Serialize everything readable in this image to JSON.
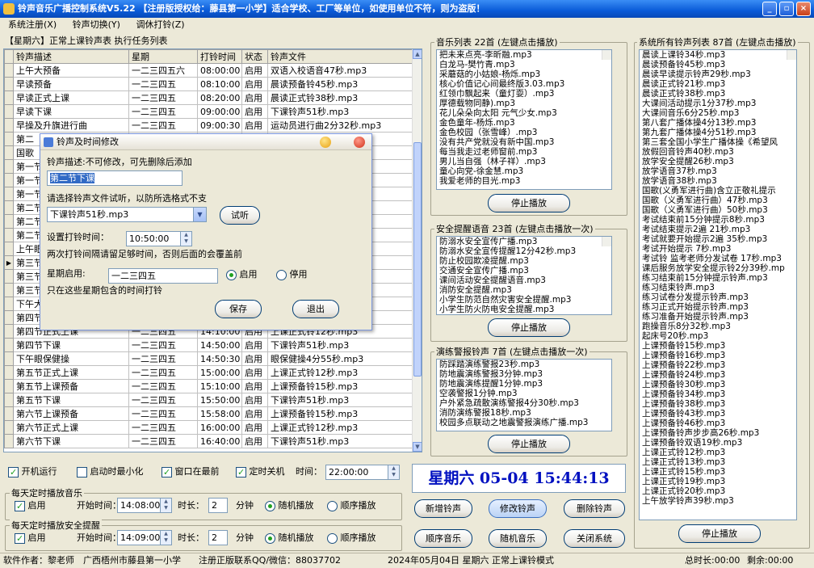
{
  "window": {
    "title": "铃声音乐广播控制系统V5.22 【注册版授权给：藤县第一小学】适合学校、工厂等单位，如使用单位不符，则为盗版！",
    "min_glyph": "_",
    "restore_glyph": "▫",
    "close_glyph": "×"
  },
  "menu": [
    "系统注册(X)",
    "铃声切换(Y)",
    "调休打铃(Z)"
  ],
  "schedule": {
    "title": "【星期六】正常上课铃声表 执行任务列表",
    "columns": [
      "铃声描述",
      "星期",
      "打铃时间",
      "状态",
      "铃声文件"
    ],
    "current_row_marker": "▶",
    "rows": [
      [
        "上午大预备",
        "一二三四五六",
        "08:00:00",
        "启用",
        "双语入校语音47秒.mp3"
      ],
      [
        "早读预备",
        "一二三四五",
        "08:10:00",
        "启用",
        "晨读预备铃45秒.mp3"
      ],
      [
        "早读正式上课",
        "一二三四五",
        "08:20:00",
        "启用",
        "晨读正式铃38秒.mp3"
      ],
      [
        "早读下课",
        "一二三四五",
        "09:00:00",
        "启用",
        "下课铃声51秒.mp3"
      ],
      [
        "早操及升旗进行曲",
        "一二三四五",
        "09:00:30",
        "启用",
        "运动员进行曲2分32秒.mp3"
      ],
      [
        "第二",
        "",
        "",
        "",
        "操《希望"
      ],
      [
        "国歌",
        "",
        "",
        "",
        ""
      ],
      [
        "第一节",
        "",
        "",
        "",
        ""
      ],
      [
        "第一节",
        "",
        "",
        "",
        ""
      ],
      [
        "第一节",
        "",
        "",
        "",
        ""
      ],
      [
        "第二节",
        "",
        "",
        "",
        ""
      ],
      [
        "第二节",
        "",
        "",
        "",
        ""
      ],
      [
        "第二节",
        "",
        "",
        "",
        ""
      ],
      [
        "上午眼",
        "",
        "",
        "",
        ""
      ],
      [
        "第三节",
        "",
        "",
        "",
        ""
      ],
      [
        "第三节",
        "",
        "",
        "",
        ""
      ],
      [
        "第三节",
        "",
        "",
        "",
        ""
      ],
      [
        "下午大",
        "",
        "",
        "",
        ""
      ],
      [
        "第四节",
        "",
        "",
        "",
        ""
      ],
      [
        "第四节正式上课",
        "一二三四五",
        "14:10:00",
        "启用",
        "上课正式铃12秒.mp3"
      ],
      [
        "第四节下课",
        "一二三四五",
        "14:50:00",
        "启用",
        "下课铃声51秒.mp3"
      ],
      [
        "下午眼保健操",
        "一二三四五",
        "14:50:30",
        "启用",
        "眼保健操4分55秒.mp3"
      ],
      [
        "第五节正式上课",
        "一二三四五",
        "15:00:00",
        "启用",
        "上课正式铃12秒.mp3"
      ],
      [
        "第五节上课预备",
        "一二三四五",
        "15:10:00",
        "启用",
        "上课预备铃15秒.mp3"
      ],
      [
        "第五节下课",
        "一二三四五",
        "15:50:00",
        "启用",
        "下课铃声51秒.mp3"
      ],
      [
        "第六节上课预备",
        "一二三四五",
        "15:58:00",
        "启用",
        "上课预备铃15秒.mp3"
      ],
      [
        "第六节正式上课",
        "一二三四五",
        "16:00:00",
        "启用",
        "上课正式铃12秒.mp3"
      ],
      [
        "第六节下课",
        "一二三四五",
        "16:40:00",
        "启用",
        "下课铃声51秒.mp3"
      ]
    ],
    "scroll_up": "▲",
    "scroll_down": "▼"
  },
  "music": {
    "title": "音乐列表 22首 (左键点击播放)",
    "items": [
      "把未来点亮-李昕融.mp3",
      "白龙马-樊竹青.mp3",
      "采蘑菇的小姑娘-杨烁.mp3",
      "核心价值记心间最终版3.03.mp3",
      "红领巾飘起来（童灯耍）.mp3",
      "厚德载物同静).mp3",
      "花儿朵朵向太阳 元气少女.mp3",
      "金色童年-杨烁.mp3",
      "金色校园（张雪峰）.mp3",
      "没有共产党就没有新中国.mp3",
      "每当我走过老师窗前.mp3",
      "男儿当自强（林子祥）.mp3",
      "童心向党-徐金慧.mp3",
      "我爱老师的目光.mp3"
    ],
    "stop_label": "停止播放"
  },
  "safety": {
    "title": "安全提醒语音 23首 (左键点击播放一次)",
    "items": [
      "防溺水安全宣传广播.mp3",
      "防溺水安全宣传提醒12分42秒.mp3",
      "防止校园欺凌提醒.mp3",
      "交通安全宣传广播.mp3",
      "课间活动安全提醒语音.mp3",
      "消防安全提醒.mp3",
      "小学生防范自然灾害安全提醒.mp3",
      "小学生防火防电安全提醒.mp3"
    ],
    "stop_label": "停止播放"
  },
  "drill": {
    "title": "演练警报铃声 7首 (左键点击播放一次)",
    "items": [
      "防踩踏演练警报23秒.mp3",
      "防地震演练警报3分钟.mp3",
      "防地震演练提醒1分钟.mp3",
      "空袭警报1分钟.mp3",
      "户外紧急疏散演练警报4分30秒.mp3",
      "消防演练警报18秒.mp3",
      "校园多点联动之地震警报演练广播.mp3"
    ],
    "stop_label": "停止播放"
  },
  "allrings": {
    "title": "系统所有铃声列表 87首 (左键点击播放)",
    "items": [
      "晨读上课铃34秒.mp3",
      "晨读预备铃45秒.mp3",
      "晨读早读提示铃声29秒.mp3",
      "晨读正式铃21秒.mp3",
      "晨读正式铃38秒.mp3",
      "大课间活动提示1分37秒.mp3",
      "大课间音乐6分25秒.mp3",
      "第八套广播体操4分13秒.mp3",
      "第九套广播体操4分51秒.mp3",
      "第三套全国小学生广播体操《希望风",
      "放假回音铃声40秒.mp3",
      "放学安全提醒26秒.mp3",
      "放学语音37秒.mp3",
      "放学语音38秒.mp3",
      "国歌(义勇军进行曲)含立正敬礼提示",
      "国歌（义勇军进行曲）47秒.mp3",
      "国歌（义勇军进行曲）50秒.mp3",
      "考试结束前15分钟提示8秒.mp3",
      "考试结束提示2遍 21秒.mp3",
      "考试就要开始提示2遍 35秒.mp3",
      "考试开始提示 7秒.mp3",
      "考试铃 监考老师分发试卷 17秒.mp3",
      "课后服务放学安全提示铃2分39秒.mp",
      "练习结束前15分钟提示铃声.mp3",
      "练习结束铃声.mp3",
      "练习试卷分发提示铃声.mp3",
      "练习正式开始提示铃声.mp3",
      "练习准备开始提示铃声.mp3",
      "跑操音乐8分32秒.mp3",
      "起床号20秒.mp3",
      "上课预备铃15秒.mp3",
      "上课预备铃16秒.mp3",
      "上课预备铃22秒.mp3",
      "上课预备铃24秒.mp3",
      "上课预备铃30秒.mp3",
      "上课预备铃34秒.mp3",
      "上课预备铃38秒.mp3",
      "上课预备铃43秒.mp3",
      "上课预备铃46秒.mp3",
      "上课预备铃声步步高26秒.mp3",
      "上课预备铃双语19秒.mp3",
      "上课正式铃12秒.mp3",
      "上课正式铃13秒.mp3",
      "上课正式铃15秒.mp3",
      "上课正式铃19秒.mp3",
      "上课正式铃20秒.mp3",
      "上午放学铃声39秒.mp3"
    ],
    "stop_label": "停止播放"
  },
  "dialog": {
    "title": "铃声及时间修改",
    "desc_label": "铃声描述:不可修改，可先删除后添加",
    "desc_value": "第二节下课",
    "file_label": "请选择铃声文件试听，以防所选格式不支",
    "file_value": "下课铃声51秒.mp3",
    "listen_label": "试听",
    "time_label": "设置打铃时间：",
    "time_value": "10:50:00",
    "hint": "两次打铃间隔请留足够时间，否则后面的会覆盖前",
    "week_label": "星期启用:",
    "week_value": "一二三四五",
    "enable_label": "启用",
    "disable_label": "停用",
    "week_hint": "只在这些星期包含的时间打铃",
    "save_label": "保存",
    "exit_label": "退出"
  },
  "controls": {
    "auto_run": "开机运行",
    "start_min": "启动时最小化",
    "topmost": "窗口在最前",
    "timed_shutdown": "定时关机",
    "time_label": "时间：",
    "shutdown_time": "22:00:00",
    "daily_music": {
      "title": "每天定时播放音乐",
      "enable": "启用",
      "start_label": "开始时间：",
      "start": "14:08:00",
      "dur_label": "时长：",
      "dur": "2",
      "unit": "分钟",
      "random": "随机播放",
      "order": "顺序播放"
    },
    "daily_safety": {
      "title": "每天定时播放安全提醒",
      "enable": "启用",
      "start_label": "开始时间：",
      "start": "14:09:00",
      "dur_label": "时长：",
      "dur": "2",
      "unit": "分钟",
      "random": "随机播放",
      "order": "顺序播放"
    }
  },
  "clock": "星期六 05-04 15:44:13",
  "actions": [
    "新增铃声",
    "修改铃声",
    "删除铃声",
    "顺序音乐",
    "随机音乐",
    "关闭系统"
  ],
  "status": {
    "author": "软件作者：黎老师",
    "school": "广西梧州市藤县第一小学",
    "contact": "注册正版联系QQ/微信：88037702",
    "mode": "2024年05月04日 星期六 正常上课铃模式",
    "total": "总时长:00:00",
    "remain": "剩余:00:00"
  },
  "colors": {
    "titlebar": "#0A5BD8",
    "clock_text": "#0010C0",
    "check": "#21A121"
  }
}
